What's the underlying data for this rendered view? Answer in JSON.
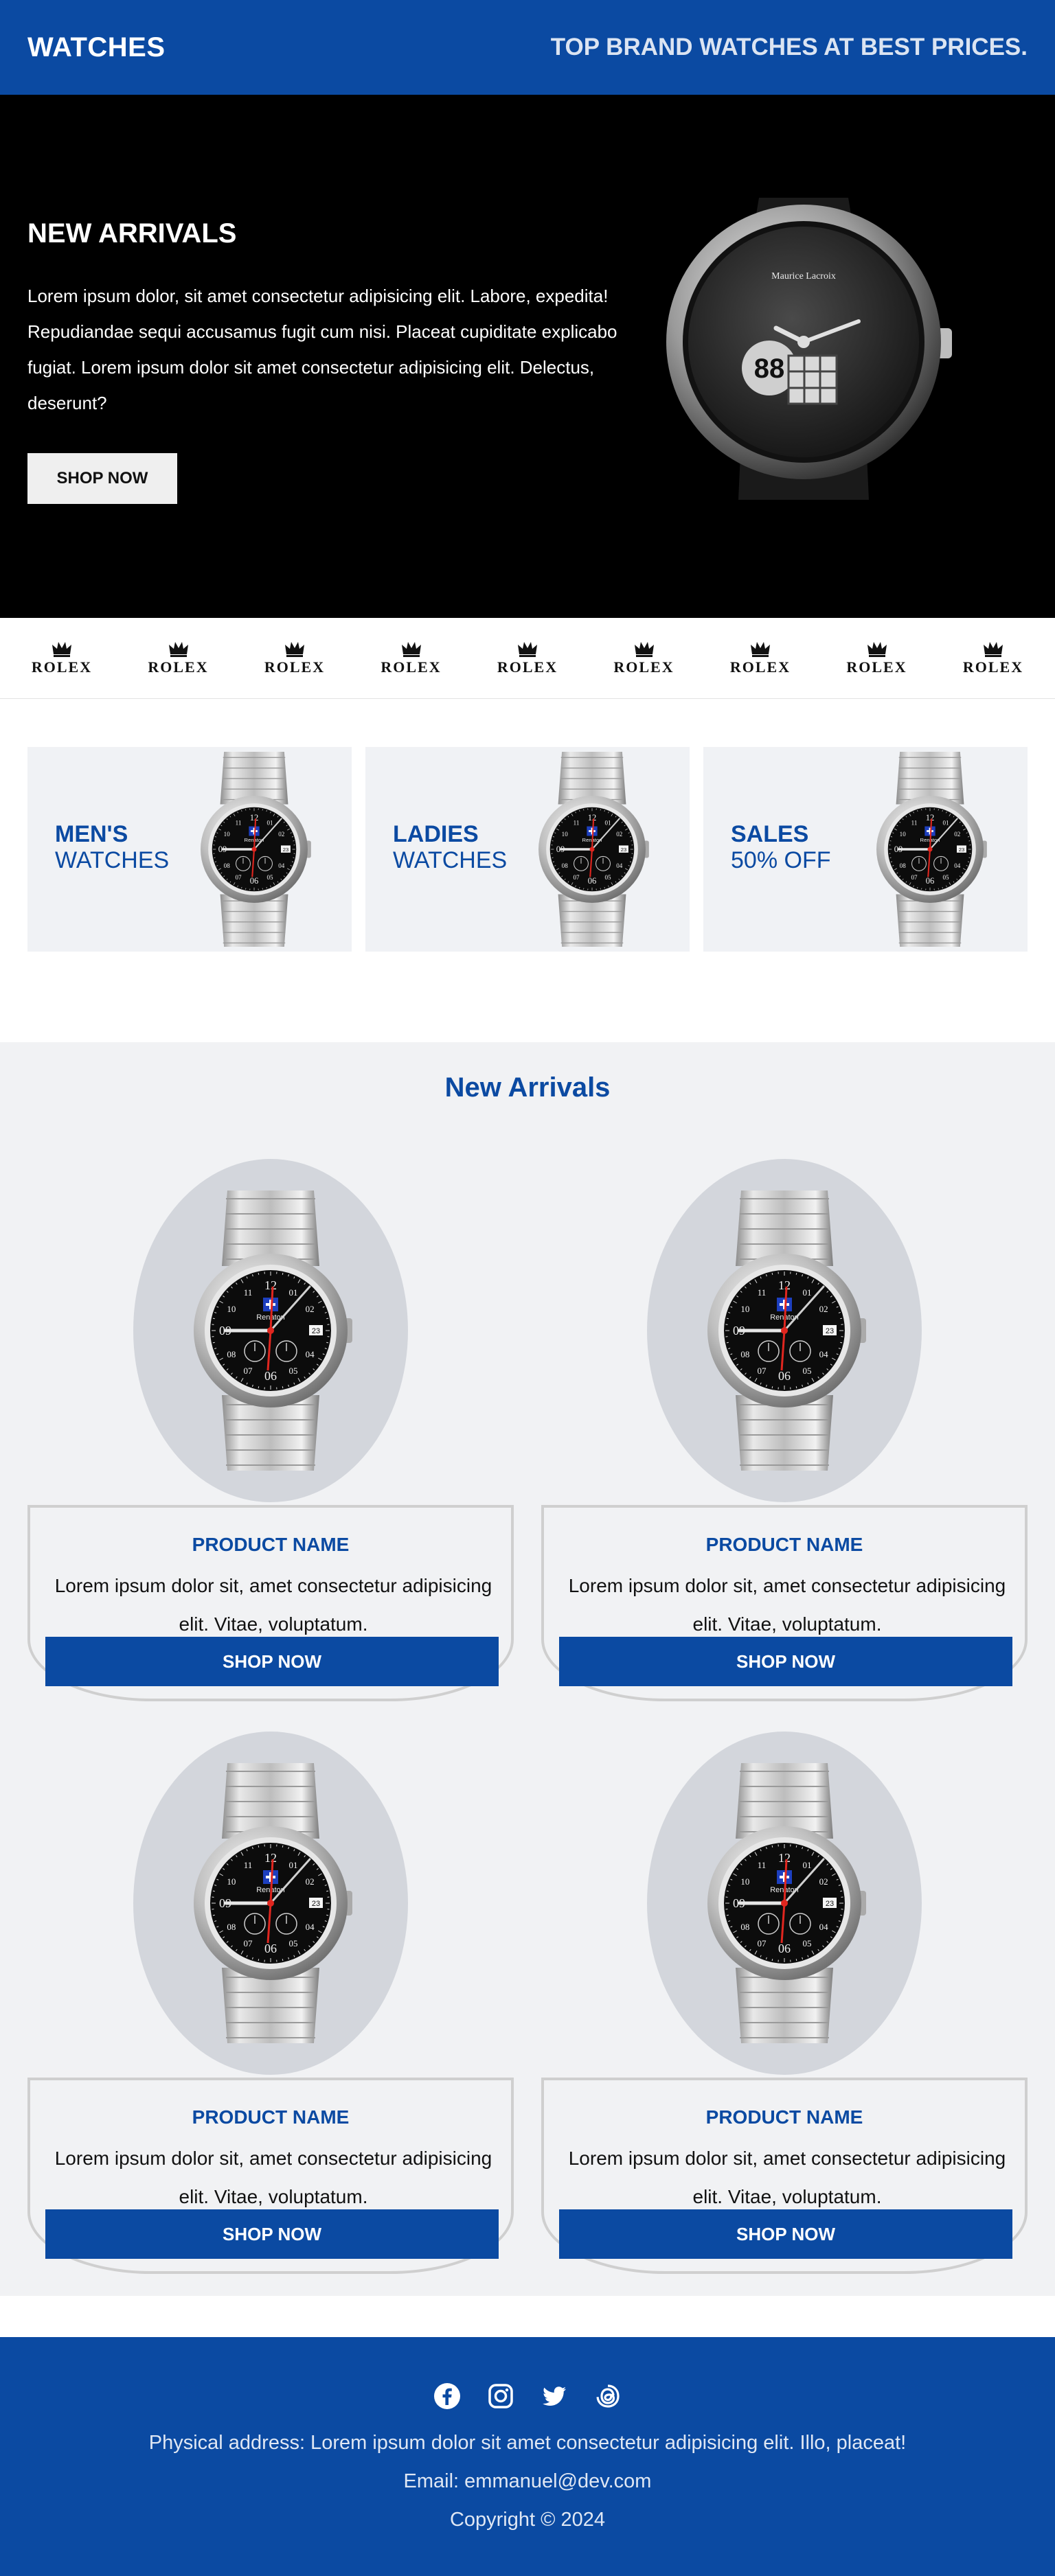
{
  "header": {
    "brand": "WATCHES",
    "tagline": "TOP BRAND WATCHES AT BEST PRICES."
  },
  "hero": {
    "title": "NEW ARRIVALS",
    "body": "Lorem ipsum dolor, sit amet consectetur adipisicing elit. Labore, expedita! Repudiandae sequi accusamus fugit cum nisi. Placeat cupiditate explicabo fugiat. Lorem ipsum dolor sit amet consectetur adipisicing elit. Delectus, deserunt?",
    "button": "SHOP NOW",
    "watch_brand": "Maurice Lacroix"
  },
  "brands": [
    "ROLEX",
    "ROLEX",
    "ROLEX",
    "ROLEX",
    "ROLEX",
    "ROLEX",
    "ROLEX",
    "ROLEX",
    "ROLEX"
  ],
  "categories": [
    {
      "line1": "MEN'S",
      "line2": "WATCHES"
    },
    {
      "line1": "LADIES",
      "line2": "WATCHES"
    },
    {
      "line1": "SALES",
      "line2": "50% OFF"
    }
  ],
  "arrivals": {
    "title": "New Arrivals",
    "products": [
      {
        "name": "PRODUCT NAME",
        "desc": "Lorem ipsum dolor sit, amet consectetur adipisicing elit. Vitae, voluptatum.",
        "button": "SHOP NOW"
      },
      {
        "name": "PRODUCT NAME",
        "desc": "Lorem ipsum dolor sit, amet consectetur adipisicing elit. Vitae, voluptatum.",
        "button": "SHOP NOW"
      },
      {
        "name": "PRODUCT NAME",
        "desc": "Lorem ipsum dolor sit, amet consectetur adipisicing elit. Vitae, voluptatum.",
        "button": "SHOP NOW"
      },
      {
        "name": "PRODUCT NAME",
        "desc": "Lorem ipsum dolor sit, amet consectetur adipisicing elit. Vitae, voluptatum.",
        "button": "SHOP NOW"
      }
    ]
  },
  "watch_dial": {
    "brand": "Renaton",
    "numerals": [
      "12",
      "01",
      "02",
      "03",
      "04",
      "05",
      "06",
      "07",
      "08",
      "09",
      "10",
      "11"
    ],
    "date": "23"
  },
  "footer": {
    "socials": [
      "facebook-icon",
      "instagram-icon",
      "twitter-icon",
      "threads-icon"
    ],
    "address": "Physical address: Lorem ipsum dolor sit amet consectetur adipisicing elit. Illo, placeat!",
    "email": "Email: emmanuel@dev.com",
    "copyright": "Copyright © 2024"
  },
  "colors": {
    "primary": "#0b4aa2",
    "hero_bg": "#000000",
    "section_bg": "#f1f2f4",
    "oval": "#d3d6dc"
  }
}
